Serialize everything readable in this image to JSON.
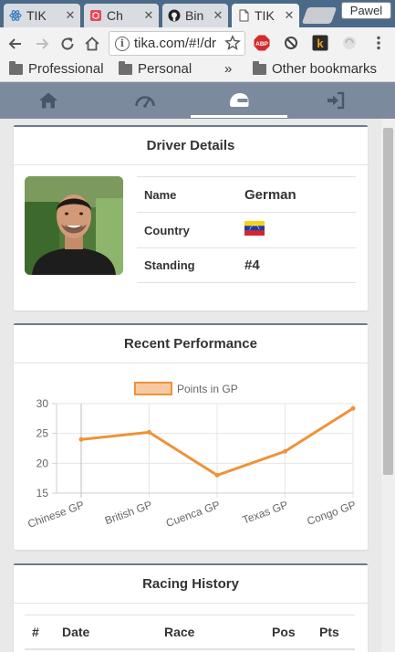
{
  "browser": {
    "tabs": [
      {
        "label": "TIK",
        "icon": "atom-icon"
      },
      {
        "label": "Ch",
        "icon": "cube-icon"
      },
      {
        "label": "Bin",
        "icon": "github-icon"
      },
      {
        "label": "TIK",
        "icon": "page-icon"
      }
    ],
    "tab_close": "✕",
    "user_name": "Pawel",
    "url": "tika.com/#!/dr",
    "extensions": [
      "ABP",
      "k"
    ],
    "bookmarks": [
      {
        "label": "Professional"
      },
      {
        "label": "Personal"
      }
    ],
    "bookmarks_more": "»",
    "other_bookmarks": "Other bookmarks"
  },
  "app_nav": [
    {
      "icon": "home-icon"
    },
    {
      "icon": "speedometer-icon"
    },
    {
      "icon": "helmet-icon",
      "active": true
    },
    {
      "icon": "sign-in-icon"
    }
  ],
  "driver_details": {
    "title": "Driver Details",
    "rows": [
      {
        "label": "Name",
        "value": "German"
      },
      {
        "label": "Country",
        "value": "",
        "flag": "venezuela-flag-icon"
      },
      {
        "label": "Standing",
        "value": "#4"
      }
    ]
  },
  "recent_performance": {
    "title": "Recent Performance"
  },
  "chart_data": {
    "type": "line",
    "categories": [
      "Chinese GP",
      "British GP",
      "Cuenca GP",
      "Texas GP",
      "Congo GP"
    ],
    "series": [
      {
        "name": "Points in GP",
        "values": [
          24,
          25.2,
          18,
          22,
          29.2
        ],
        "color": "#ef9238"
      }
    ],
    "ylim": [
      15,
      30
    ],
    "yticks": [
      "30",
      "25",
      "20",
      "15"
    ],
    "grid": true,
    "legend": "top-center"
  },
  "racing_history": {
    "title": "Racing History",
    "columns": [
      "#",
      "Date",
      "Race",
      "Pos",
      "Pts"
    ]
  }
}
